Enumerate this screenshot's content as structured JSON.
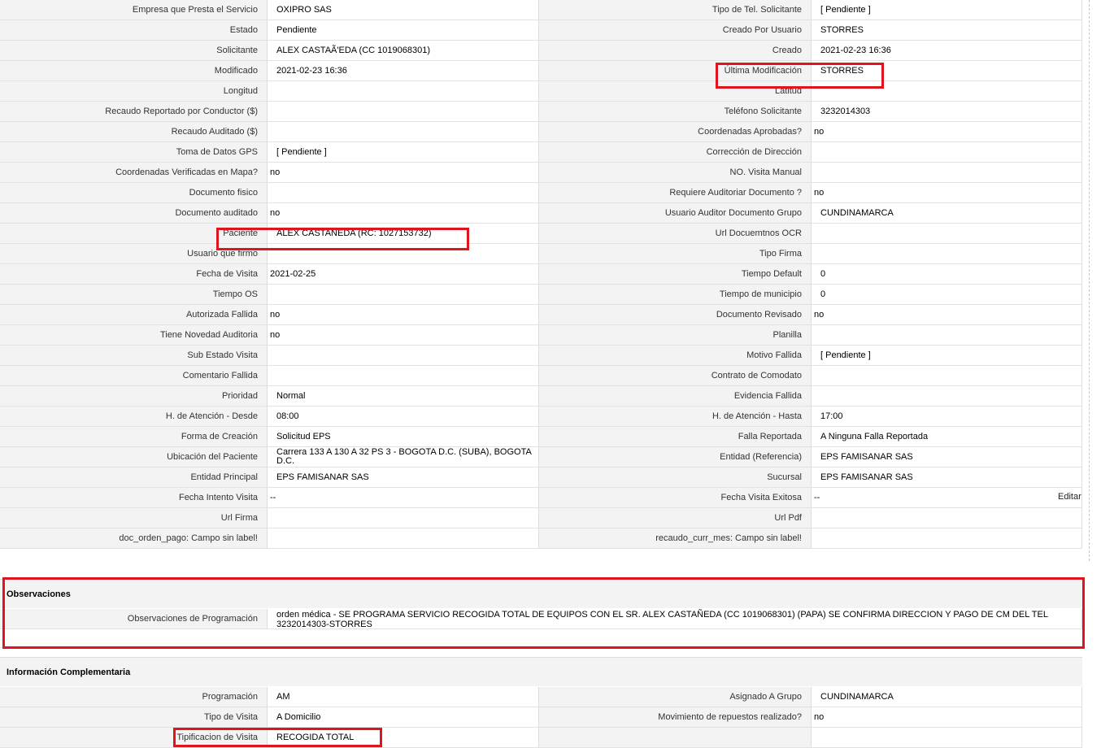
{
  "rows": [
    {
      "l1": "Empresa que Presta el Servicio",
      "v1": "OXIPRO SAS",
      "l2": "Tipo de Tel. Solicitante",
      "v2": "[ Pendiente ]"
    },
    {
      "l1": "Estado",
      "v1": "Pendiente",
      "l2": "Creado Por Usuario",
      "v2": "STORRES"
    },
    {
      "l1": "Solicitante",
      "v1": "ALEX CASTAÃ'EDA (CC 1019068301)",
      "l2": "Creado",
      "v2": "2021-02-23 16:36"
    },
    {
      "l1": "Modificado",
      "v1": "2021-02-23 16:36",
      "l2": "Última Modificación",
      "v2": "STORRES"
    },
    {
      "l1": "Longitud",
      "v1": "",
      "l2": "Latitud",
      "v2": ""
    },
    {
      "l1": "Recaudo Reportado por Conductor ($)",
      "v1": "",
      "l2": "Teléfono Solicitante",
      "v2": "3232014303"
    },
    {
      "l1": "Recaudo Auditado ($)",
      "v1": "",
      "l2": "Coordenadas Aprobadas?",
      "v2": "no"
    },
    {
      "l1": "Toma de Datos GPS",
      "v1": "[ Pendiente ]",
      "l2": "Corrección de Dirección",
      "v2": ""
    },
    {
      "l1": "Coordenadas Verificadas en Mapa?",
      "v1": "no",
      "l2": "NO. Visita Manual",
      "v2": ""
    },
    {
      "l1": "Documento fisico",
      "v1": "",
      "l2": "Requiere Auditoriar Documento ?",
      "v2": "no"
    },
    {
      "l1": "Documento auditado",
      "v1": "no",
      "l2": "Usuario Auditor Documento Grupo",
      "v2": "CUNDINAMARCA"
    },
    {
      "l1": "Paciente",
      "v1": "ALEX CASTAÑEDA (RC: 1027153732)",
      "l2": "Url Docuemtnos OCR",
      "v2": ""
    },
    {
      "l1": "Usuario que firmo",
      "v1": "",
      "l2": "Tipo Firma",
      "v2": ""
    },
    {
      "l1": "Fecha de Visita",
      "v1": "2021-02-25",
      "l2": "Tiempo Default",
      "v2": "0"
    },
    {
      "l1": "Tiempo OS",
      "v1": "",
      "l2": "Tiempo de municipio",
      "v2": "0"
    },
    {
      "l1": "Autorizada Fallida",
      "v1": "no",
      "l2": "Documento Revisado",
      "v2": "no"
    },
    {
      "l1": "Tiene Novedad Auditoria",
      "v1": "no",
      "l2": "Planilla",
      "v2": ""
    },
    {
      "l1": "Sub Estado Visita",
      "v1": "",
      "l2": "Motivo Fallida",
      "v2": "[ Pendiente ]"
    },
    {
      "l1": "Comentario Fallida",
      "v1": "",
      "l2": "Contrato de Comodato",
      "v2": ""
    },
    {
      "l1": "Prioridad",
      "v1": "Normal",
      "l2": "Evidencia Fallida",
      "v2": ""
    },
    {
      "l1": "H. de Atención - Desde",
      "v1": "08:00",
      "l2": "H. de Atención - Hasta",
      "v2": "17:00"
    },
    {
      "l1": "Forma de Creación",
      "v1": "Solicitud EPS",
      "l2": "Falla Reportada",
      "v2": "A Ninguna Falla Reportada"
    },
    {
      "l1": "Ubicación del Paciente",
      "v1": "Carrera 133 A 130 A 32 PS 3 - BOGOTA D.C. (SUBA), BOGOTA D.C.",
      "l2": "Entidad (Referencia)",
      "v2": "EPS FAMISANAR SAS"
    },
    {
      "l1": "Entidad Principal",
      "v1": "EPS FAMISANAR SAS",
      "l2": "Sucursal",
      "v2": "EPS FAMISANAR SAS"
    },
    {
      "l1": "Fecha Intento Visita",
      "v1": "--",
      "l2": "Fecha Visita Exitosa",
      "v2": "--"
    },
    {
      "l1": "Url Firma",
      "v1": "",
      "l2": "Url Pdf",
      "v2": ""
    },
    {
      "l1": "doc_orden_pago: Campo sin label!",
      "v1": "",
      "l2": "recaudo_curr_mes: Campo sin label!",
      "v2": ""
    }
  ],
  "edit_label": "Editar",
  "observaciones": {
    "title": "Observaciones",
    "label": "Observaciones de Programación",
    "value": "orden médica - SE PROGRAMA SERVICIO RECOGIDA TOTAL DE EQUIPOS CON EL SR. ALEX CASTAÑEDA (CC 1019068301) (PAPA) SE CONFIRMA DIRECCION Y PAGO DE CM DEL TEL 3232014303-STORRES"
  },
  "info": {
    "title": "Información Complementaria",
    "rows": [
      {
        "l1": "Programación",
        "v1": "AM",
        "l2": "Asignado A Grupo",
        "v2": "CUNDINAMARCA"
      },
      {
        "l1": "Tipo de Visita",
        "v1": "A Domicilio",
        "l2": "Movimiento de repuestos realizado?",
        "v2": "no"
      },
      {
        "l1": "Tipificacion de Visita",
        "v1": "RECOGIDA TOTAL",
        "l2": "",
        "v2": ""
      }
    ]
  },
  "colors": {
    "highlight": "#e0141e",
    "label_bg": "#f3f3f3"
  }
}
